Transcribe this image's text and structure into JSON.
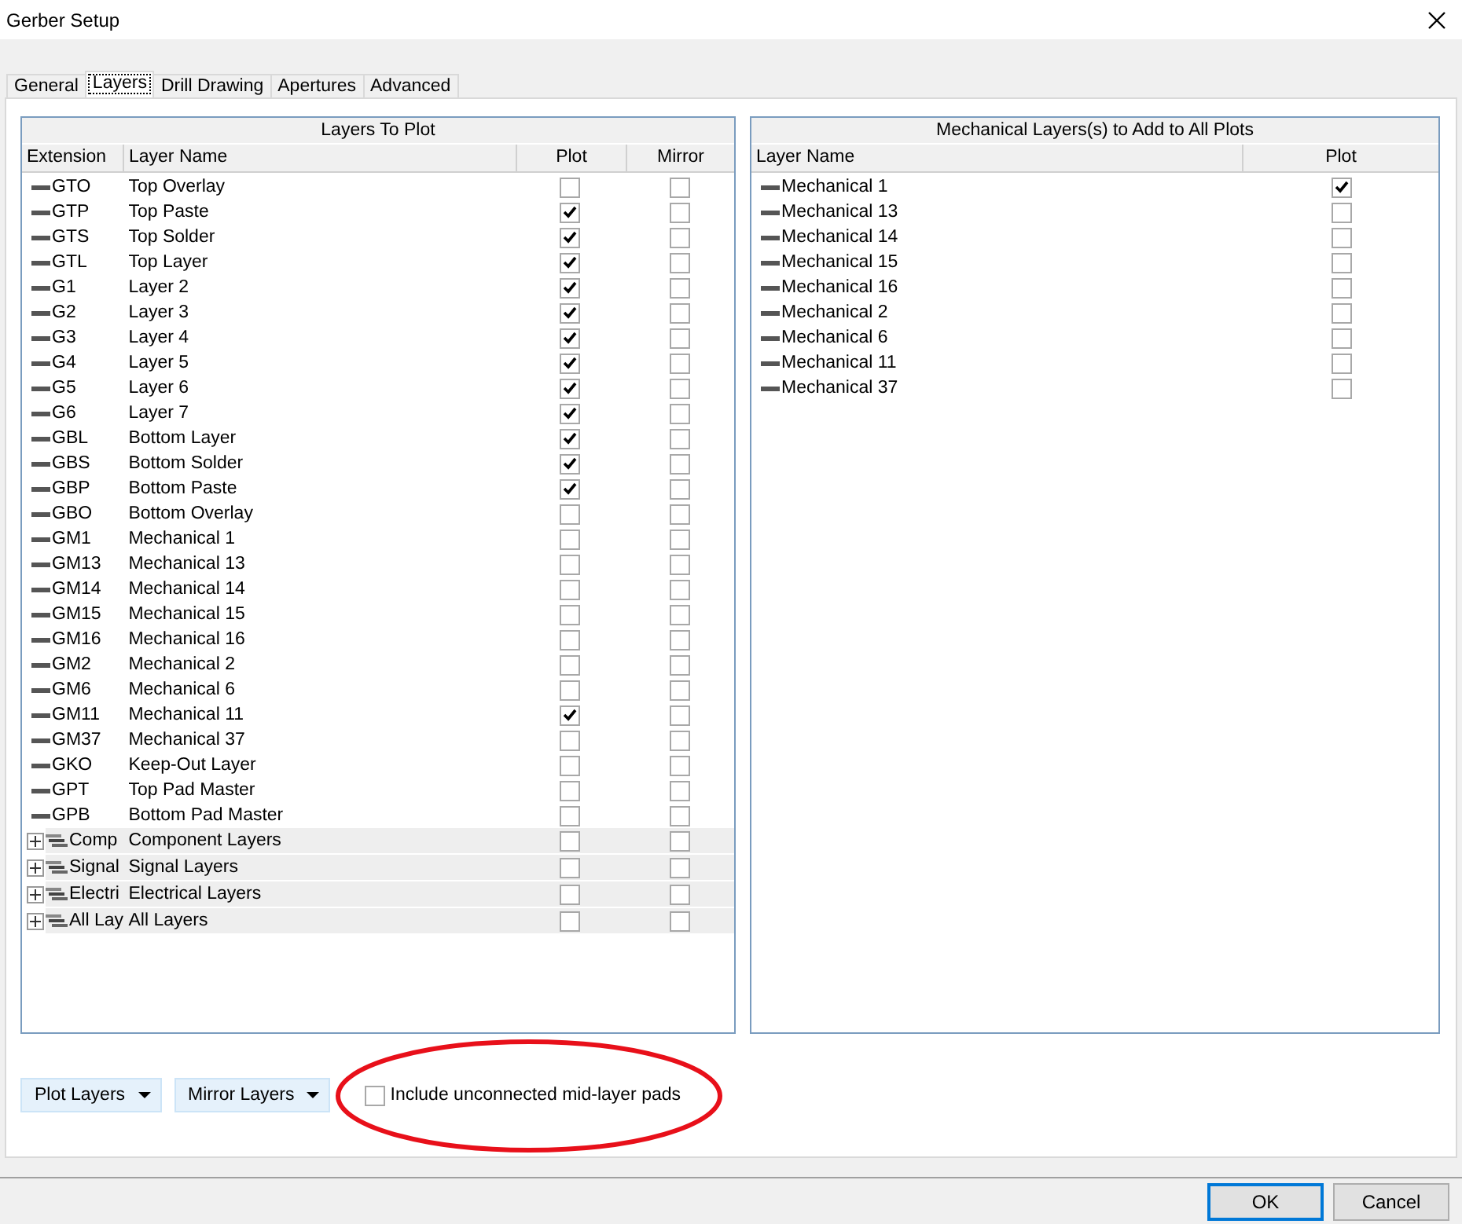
{
  "window": {
    "title": "Gerber Setup"
  },
  "tabs": [
    {
      "label": "General",
      "selected": false
    },
    {
      "label": "Layers",
      "selected": true
    },
    {
      "label": "Drill Drawing",
      "selected": false
    },
    {
      "label": "Apertures",
      "selected": false
    },
    {
      "label": "Advanced",
      "selected": false
    }
  ],
  "layers_to_plot": {
    "title": "Layers To Plot",
    "columns": [
      "Extension",
      "Layer Name",
      "Plot",
      "Mirror"
    ],
    "rows": [
      {
        "kind": "layer",
        "extension": "GTO",
        "name": "Top Overlay",
        "plot": false,
        "mirror": false
      },
      {
        "kind": "layer",
        "extension": "GTP",
        "name": "Top Paste",
        "plot": true,
        "mirror": false
      },
      {
        "kind": "layer",
        "extension": "GTS",
        "name": "Top Solder",
        "plot": true,
        "mirror": false
      },
      {
        "kind": "layer",
        "extension": "GTL",
        "name": "Top Layer",
        "plot": true,
        "mirror": false
      },
      {
        "kind": "layer",
        "extension": "G1",
        "name": "Layer 2",
        "plot": true,
        "mirror": false
      },
      {
        "kind": "layer",
        "extension": "G2",
        "name": "Layer 3",
        "plot": true,
        "mirror": false
      },
      {
        "kind": "layer",
        "extension": "G3",
        "name": "Layer 4",
        "plot": true,
        "mirror": false
      },
      {
        "kind": "layer",
        "extension": "G4",
        "name": "Layer 5",
        "plot": true,
        "mirror": false
      },
      {
        "kind": "layer",
        "extension": "G5",
        "name": "Layer 6",
        "plot": true,
        "mirror": false
      },
      {
        "kind": "layer",
        "extension": "G6",
        "name": "Layer 7",
        "plot": true,
        "mirror": false
      },
      {
        "kind": "layer",
        "extension": "GBL",
        "name": "Bottom Layer",
        "plot": true,
        "mirror": false
      },
      {
        "kind": "layer",
        "extension": "GBS",
        "name": "Bottom Solder",
        "plot": true,
        "mirror": false
      },
      {
        "kind": "layer",
        "extension": "GBP",
        "name": "Bottom Paste",
        "plot": true,
        "mirror": false
      },
      {
        "kind": "layer",
        "extension": "GBO",
        "name": "Bottom Overlay",
        "plot": false,
        "mirror": false
      },
      {
        "kind": "layer",
        "extension": "GM1",
        "name": "Mechanical 1",
        "plot": false,
        "mirror": false
      },
      {
        "kind": "layer",
        "extension": "GM13",
        "name": "Mechanical 13",
        "plot": false,
        "mirror": false
      },
      {
        "kind": "layer",
        "extension": "GM14",
        "name": "Mechanical 14",
        "plot": false,
        "mirror": false
      },
      {
        "kind": "layer",
        "extension": "GM15",
        "name": "Mechanical 15",
        "plot": false,
        "mirror": false
      },
      {
        "kind": "layer",
        "extension": "GM16",
        "name": "Mechanical 16",
        "plot": false,
        "mirror": false
      },
      {
        "kind": "layer",
        "extension": "GM2",
        "name": "Mechanical 2",
        "plot": false,
        "mirror": false
      },
      {
        "kind": "layer",
        "extension": "GM6",
        "name": "Mechanical 6",
        "plot": false,
        "mirror": false
      },
      {
        "kind": "layer",
        "extension": "GM11",
        "name": "Mechanical 11",
        "plot": true,
        "mirror": false
      },
      {
        "kind": "layer",
        "extension": "GM37",
        "name": "Mechanical 37",
        "plot": false,
        "mirror": false
      },
      {
        "kind": "layer",
        "extension": "GKO",
        "name": "Keep-Out Layer",
        "plot": false,
        "mirror": false
      },
      {
        "kind": "layer",
        "extension": "GPT",
        "name": "Top Pad Master",
        "plot": false,
        "mirror": false
      },
      {
        "kind": "layer",
        "extension": "GPB",
        "name": "Bottom Pad Master",
        "plot": false,
        "mirror": false
      },
      {
        "kind": "group",
        "extension": "Comp",
        "name": "Component Layers",
        "plot": false,
        "mirror": false,
        "expanded": false
      },
      {
        "kind": "group",
        "extension": "Signal",
        "name": "Signal Layers",
        "plot": false,
        "mirror": false,
        "expanded": false
      },
      {
        "kind": "group",
        "extension": "Electri",
        "name": "Electrical Layers",
        "plot": false,
        "mirror": false,
        "expanded": false
      },
      {
        "kind": "group",
        "extension": "All Lay",
        "name": "All Layers",
        "plot": false,
        "mirror": false,
        "expanded": false
      }
    ]
  },
  "mechanical_layers": {
    "title": "Mechanical Layers(s) to Add to All Plots",
    "columns": [
      "Layer Name",
      "Plot"
    ],
    "rows": [
      {
        "name": "Mechanical 1",
        "plot": true
      },
      {
        "name": "Mechanical 13",
        "plot": false
      },
      {
        "name": "Mechanical 14",
        "plot": false
      },
      {
        "name": "Mechanical 15",
        "plot": false
      },
      {
        "name": "Mechanical 16",
        "plot": false
      },
      {
        "name": "Mechanical 2",
        "plot": false
      },
      {
        "name": "Mechanical 6",
        "plot": false
      },
      {
        "name": "Mechanical 11",
        "plot": false
      },
      {
        "name": "Mechanical 37",
        "plot": false
      }
    ]
  },
  "plot_layers_button": "Plot Layers",
  "mirror_layers_button": "Mirror Layers",
  "include_pads": {
    "label": "Include unconnected mid-layer pads",
    "checked": false
  },
  "buttons": [
    "OK",
    "Cancel"
  ]
}
